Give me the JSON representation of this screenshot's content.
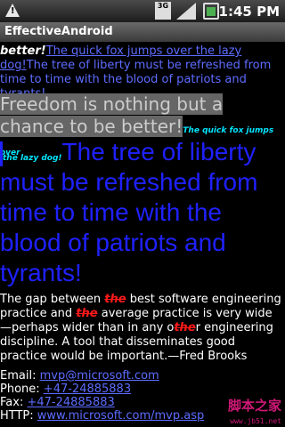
{
  "status_bar": {
    "network": "3G",
    "time": "1:45 PM"
  },
  "app": {
    "title": "EffectiveAndroid"
  },
  "para1": {
    "part1": "better!",
    "part2": "The quick fox jumps over the lazy dog!",
    "part3": "The tree of liberty must be refreshed from time to time with the blood of patriots and tyrants!"
  },
  "gray": {
    "main": "Freedom is nothing but a chance to be better!",
    "quick": "The quick fox jumps over",
    "lazy": "the lazy dog!"
  },
  "blue": {
    "text": "The tree of liberty must be refreshed from time to time with the blood of patriots and tyrants!"
  },
  "gap": {
    "t1": "The gap between ",
    "the1": "the",
    "t2": " best software engineering practice and ",
    "the2": "the",
    "t3": " average practice is very wide—perhaps wider  than in any o",
    "the3": "the",
    "t4": "r engineering discipline. A tool that disseminates good practice would be important.—Fred Brooks"
  },
  "contact": {
    "email_label": "Email: ",
    "email": "mvp@microsoft.com",
    "phone_label": "Phone: ",
    "phone": "+47-24885883",
    "fax_label": "Fax: ",
    "fax": "+47-24885883",
    "http_label": "HTTP: ",
    "http": "www.microsoft.com/mvp.asp"
  },
  "watermark": {
    "main": "脚本之家",
    "sub": "www.jb51.net"
  }
}
